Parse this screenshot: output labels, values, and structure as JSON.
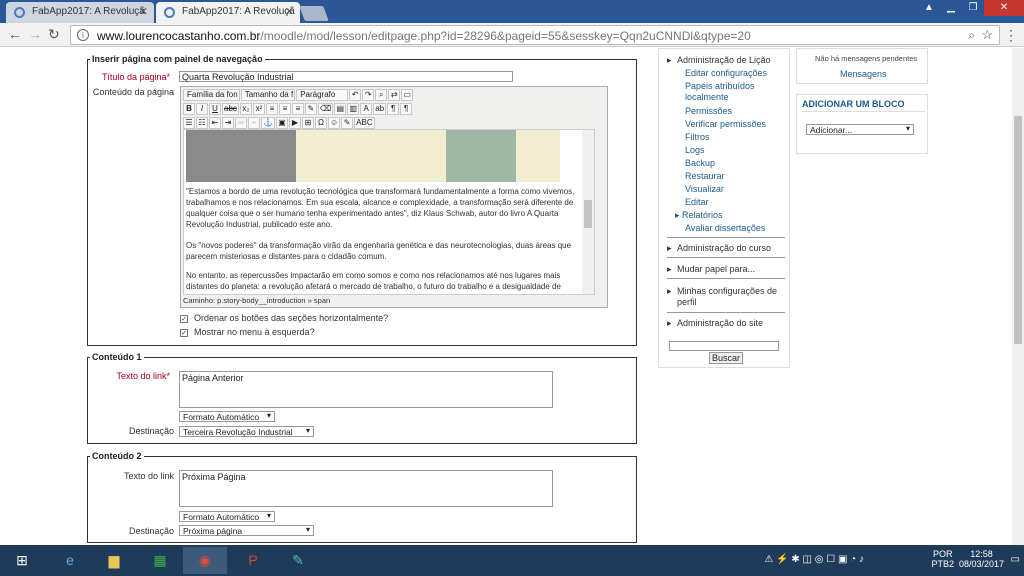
{
  "browser": {
    "tabs": [
      {
        "title": "FabApp2017: A Revoluçã",
        "active": false
      },
      {
        "title": "FabApp2017: A Revoluçã",
        "active": true
      }
    ],
    "url_host": "www.lourencocastanho.com.br",
    "url_path": "/moodle/mod/lesson/editpage.php?id=28296&pageid=55&sesskey=Qqn2uCNNDl&qtype=20"
  },
  "form": {
    "section_title": "Inserir página com painel de navegação",
    "title_label": "Título da página",
    "title_value": "Quarta Revolução Industrial",
    "content_label": "Conteúdo da página",
    "toolbar": {
      "font_family": "Família da fon",
      "font_size": "Tamanho da f",
      "paragraph": "Parágrafo"
    },
    "editor_paragraphs": [
      "\"Estamos a bordo de uma revolução tecnológica que transformará fundamentalmente a forma como vivemos, trabalhamos e nos relacionamos. Em sua escala, alcance e complexidade, a transformação será diferente de qualquer coisa que o ser humano tenha experimentado antes\", diz Klaus Schwab, autor do livro A Quarta Revolução Industrial, publicado este ano.",
      "Os \"novos poderes\" da transformação virão da engenharia genética e das neurotecnologias, duas áreas que parecem misteriosas e distantes para o cidadão comum.",
      "No entanto, as repercussões impactarão em como somos e como nos relacionamos até nos lugares mais distantes do planeta: a revolução afetará o mercado de trabalho, o futuro do trabalho e a desigualdade de renda."
    ],
    "editor_path": "Caminho: p.story-body__introduction » span",
    "checkbox_horizontal": "Ordenar os botões das seções horizontalmente?",
    "checkbox_menu": "Mostrar no menu à esquerda?",
    "content1": {
      "legend": "Conteúdo 1",
      "link_label": "Texto do link",
      "link_value": "Página Anterior",
      "format": "Formato Automático",
      "dest_label": "Destinação",
      "dest_value": "Terceira Revolução Industrial"
    },
    "content2": {
      "legend": "Conteúdo 2",
      "link_label": "Texto do link",
      "link_value": "Próxima Página",
      "format": "Formato Automático",
      "dest_label": "Destinação",
      "dest_value": "Próxima página"
    }
  },
  "admin": {
    "lesson_admin": "Administração de Lição",
    "items": [
      "Editar configurações",
      "Papéis atribuídos localmente",
      "Permissões",
      "Verificar permissões",
      "Filtros",
      "Logs",
      "Backup",
      "Restaurar",
      "Visualizar",
      "Editar",
      "Relatórios",
      "Avaliar dissertações"
    ],
    "course_admin": "Administração do curso",
    "switch_role": "Mudar papel para...",
    "profile_settings": "Minhas configurações de perfil",
    "site_admin": "Administração do site",
    "search_button": "Buscar"
  },
  "messages": {
    "none": "Não há mensagens pendentes",
    "link": "Mensagens"
  },
  "add_block": {
    "title": "ADICIONAR UM BLOCO",
    "select": "Adicionar..."
  },
  "taskbar": {
    "lang": "POR",
    "lang2": "PTB2",
    "time": "12:58",
    "date": "08/03/2017"
  }
}
